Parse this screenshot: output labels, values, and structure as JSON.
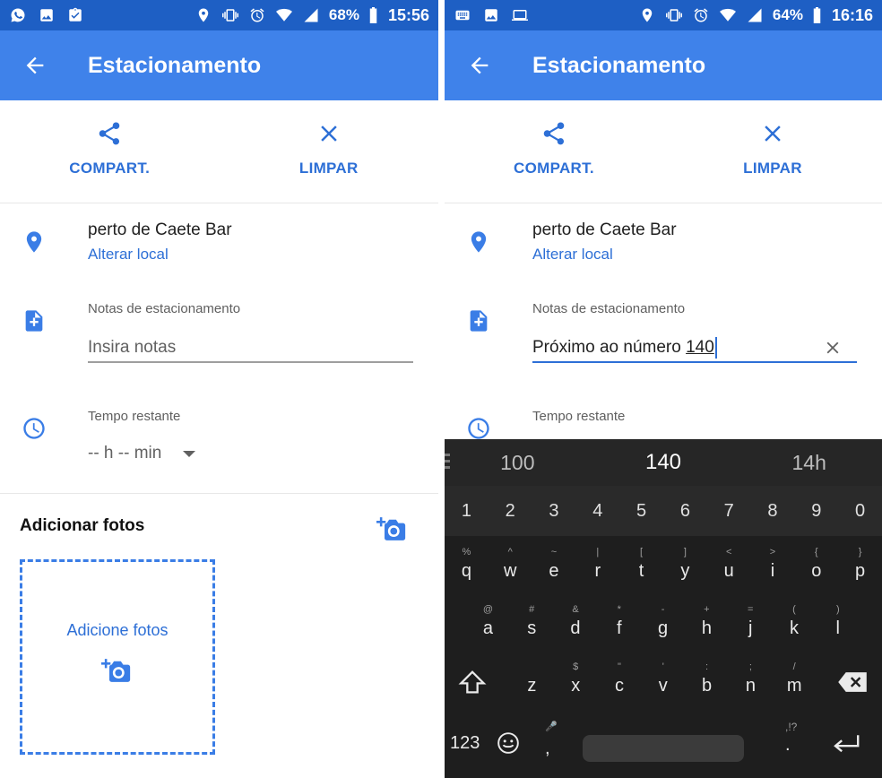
{
  "left": {
    "status": {
      "battery": "68%",
      "time": "15:56"
    },
    "appbar": {
      "title": "Estacionamento"
    },
    "actions": {
      "share": "COMPART.",
      "clear": "LIMPAR"
    },
    "place": {
      "name": "perto de Caete Bar",
      "change": "Alterar local"
    },
    "notes": {
      "label": "Notas de estacionamento",
      "placeholder": "Insira notas"
    },
    "time": {
      "label": "Tempo restante",
      "value": "-- h -- min"
    },
    "photos": {
      "title": "Adicionar fotos",
      "box_label": "Adicione fotos"
    }
  },
  "right": {
    "status": {
      "battery": "64%",
      "time": "16:16"
    },
    "appbar": {
      "title": "Estacionamento"
    },
    "actions": {
      "share": "COMPART.",
      "clear": "LIMPAR"
    },
    "place": {
      "name": "perto de Caete Bar",
      "change": "Alterar local"
    },
    "notes": {
      "label": "Notas de estacionamento",
      "value_prefix": "Próximo ao número ",
      "value_highlight": "140"
    },
    "time": {
      "label": "Tempo restante"
    },
    "keyboard": {
      "suggestions": [
        "100",
        "140",
        "14h"
      ],
      "numbers": [
        "1",
        "2",
        "3",
        "4",
        "5",
        "6",
        "7",
        "8",
        "9",
        "0"
      ],
      "row1": {
        "keys": [
          "q",
          "w",
          "e",
          "r",
          "t",
          "y",
          "u",
          "i",
          "o",
          "p"
        ],
        "hints": [
          "%",
          "^",
          "~",
          "|",
          "[",
          "]",
          "<",
          ">",
          "{",
          "}"
        ]
      },
      "row2": {
        "keys": [
          "a",
          "s",
          "d",
          "f",
          "g",
          "h",
          "j",
          "k",
          "l"
        ],
        "hints": [
          "@",
          "#",
          "&",
          "*",
          "-",
          "+",
          "=",
          "(",
          ")"
        ]
      },
      "row3": {
        "keys": [
          "z",
          "x",
          "c",
          "v",
          "b",
          "n",
          "m"
        ],
        "hints": [
          "",
          "$",
          "\"",
          "'",
          ":",
          ";",
          "/"
        ]
      },
      "bottom": {
        "mode": "123",
        "comma": ",",
        "period": ".",
        "punct_hint": ",!?"
      }
    }
  },
  "colors": {
    "statusbar": "#1e5fc4",
    "appbar": "#3f82ea",
    "accent": "#2d6fd6",
    "keyboard_bg": "#1e1e1e"
  },
  "icons": [
    "whatsapp-icon",
    "gallery-icon",
    "clipboard-check-icon",
    "keyboard-icon",
    "laptop-icon",
    "location-icon",
    "vibrate-icon",
    "alarm-icon",
    "wifi-icon",
    "signal-icon",
    "battery-icon",
    "back-arrow-icon",
    "share-icon",
    "close-icon",
    "pin-icon",
    "note-add-icon",
    "clock-icon",
    "add-photo-icon",
    "shift-icon",
    "backspace-icon",
    "emoji-icon",
    "enter-icon"
  ]
}
